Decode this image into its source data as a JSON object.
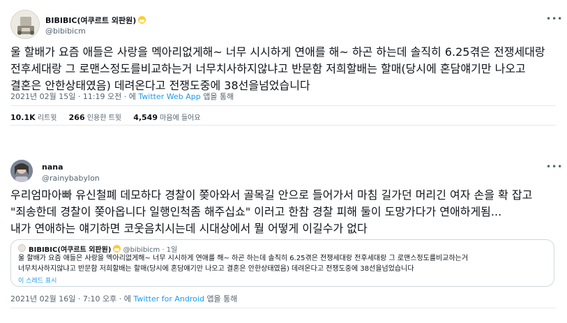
{
  "tweet1": {
    "display_name": "BIBIBIC(여쿠르트 외판원)",
    "handle": "@bibibicm",
    "avatar_icon": "avatar-image",
    "emoji_icon": "mask-face-emoji",
    "body_lines": [
      "울 할배가 요즘 애들은 사랑을 멕아리없게해~ 너무 시시하게 연애를 해~ 하곤 하는데 솔직히 6.25겪은 전쟁세대랑",
      "전후세대랑 그 로맨스정도를비교하는거 너무치사하지않냐고 반문함 저희할배는 할매(당시에 혼담얘기만 나오고",
      "결혼은 안한상태였음) 데려온다고 전쟁도중에 38선을넘었습니다"
    ],
    "date": "2021년 02월 15일",
    "time": "11:19 오전",
    "via_prefix": "에",
    "source": "Twitter Web App",
    "via_suffix": "앱을 통해",
    "stats": {
      "retweets_value": "10.1K",
      "retweets_label": "리트윗",
      "quotes_value": "266",
      "quotes_label": "인용한 트윗",
      "likes_value": "4,549",
      "likes_label": "마음에 들어요"
    }
  },
  "tweet2": {
    "display_name": "nana",
    "handle": "@rainybabylon",
    "avatar_icon": "avatar-image",
    "body_lines": [
      "우리엄마아빠 유신철폐 데모하다 경찰이 쫒아와서 골목길 안으로 들어가서 마침 길가던 머리긴 여자 손을 확 잡고",
      "\"죄송한데 경찰이 쫒아옵니다 일행인척좀 해주십쇼\" 이러고 한참 경찰 피해 둘이 도망가다가 연애하게됨...",
      "내가 연애하는 얘기하면 코웃음치시는데 시대상에서 뭘 어떻게 이길수가 없다"
    ],
    "quote": {
      "display_name": "BIBIBIC(여쿠르트 외판원)",
      "handle": "@bibibicm",
      "age": "1일",
      "body_lines": [
        "울 할배가 요즘 애들은 사랑을 멕아리없게해~ 너무 시시하게 연애를 해~ 하곤 하는데 솔직히 6.25겪은 전쟁세대랑 전후세대랑 그 로맨스정도를비교하는거",
        "너무치사하지않냐고 반문함 저희할배는 할매(당시에 혼담얘기만 나오고 결혼은 안한상태였음) 데려온다고 전쟁도중에 38선을넘었습니다"
      ],
      "show_thread": "이 스레드 표시"
    },
    "date": "2021년 02월 16일",
    "time": "7:10 오후",
    "via_prefix": "에",
    "source": "Twitter for Android",
    "via_suffix": "앱을 통해"
  },
  "more_icon": "more-dots-icon",
  "colors": {
    "text": "#0f1419",
    "secondary": "#536471",
    "link": "#1d9bf0",
    "border": "#cfd9de",
    "divider": "#e7e9ea"
  }
}
